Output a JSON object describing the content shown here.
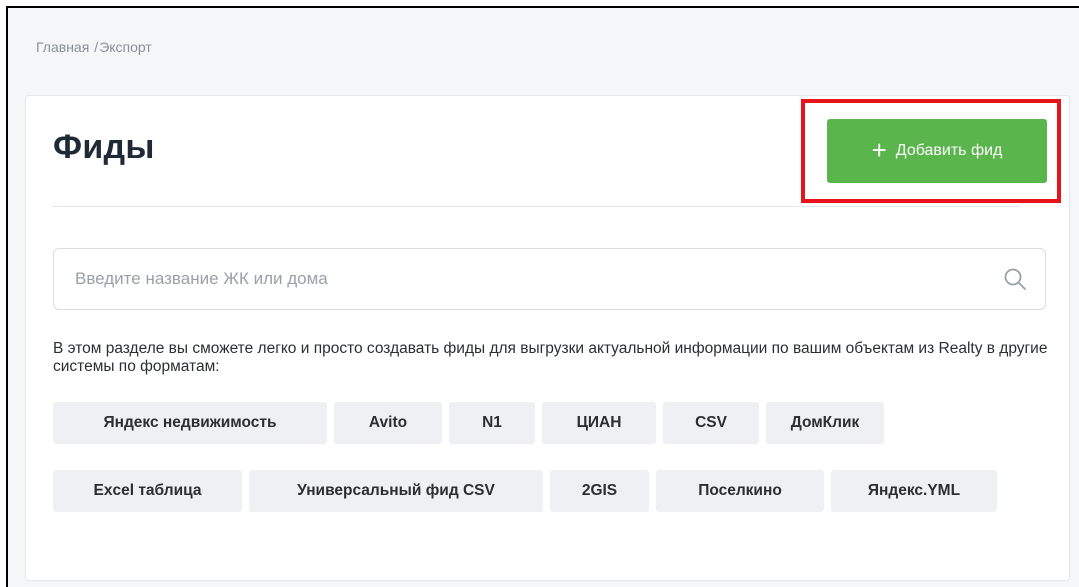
{
  "breadcrumb": {
    "home": "Главная",
    "separator": "/",
    "current": "Экспорт"
  },
  "page": {
    "title": "Фиды"
  },
  "toolbar": {
    "add_icon": "+",
    "add_label": "Добавить фид"
  },
  "search": {
    "value": "",
    "placeholder": "Введите название ЖК или дома",
    "icon": "search-icon"
  },
  "description": "В этом разделе вы сможете легко и просто создавать фиды для выгрузки актуальной информации по вашим объектам из Realty в другие системы по форматам:",
  "formats": {
    "row1": [
      "Яндекс недвижимость",
      "Avito",
      "N1",
      "ЦИАН",
      "CSV",
      "ДомКлик"
    ],
    "row2": [
      "Excel таблица",
      "Универсальный фид CSV",
      "2GIS",
      "Поселкино",
      "Яндекс.YML"
    ]
  },
  "colors": {
    "accent": "#5ab54c",
    "highlight": "#e8141b",
    "chip_background": "#eef0f3",
    "page_background": "#f5f6f8"
  }
}
